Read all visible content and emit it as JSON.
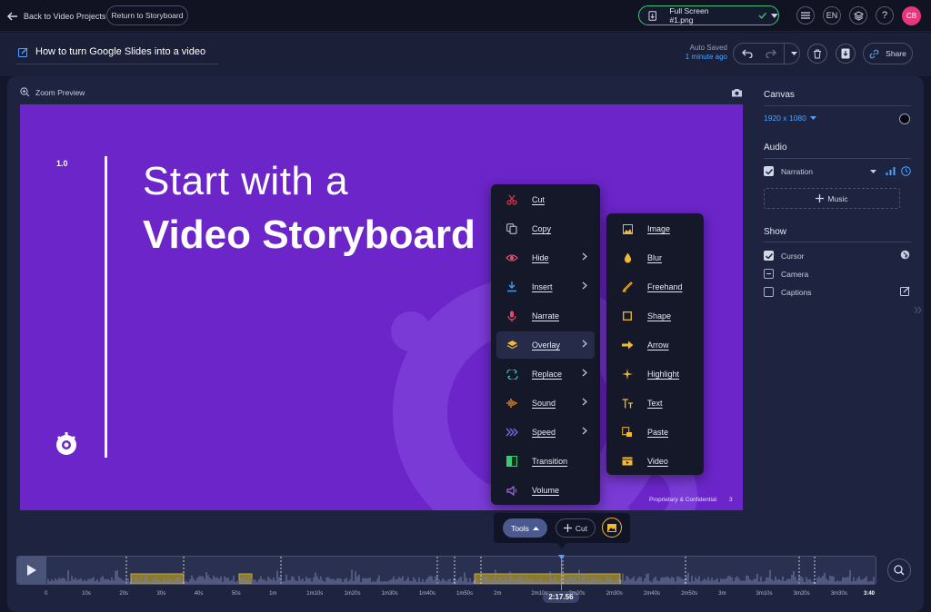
{
  "topbar": {
    "back_label": "Back to Video Projects",
    "return_label": "Return to Storyboard",
    "file_name": "Full Screen #1.png",
    "lang": "EN",
    "help": "?",
    "avatar_initials": "CB"
  },
  "header": {
    "project_title": "How to turn Google Slides into a video",
    "autosave_label": "Auto Saved",
    "autosave_time": "1 minute ago",
    "share_label": "Share"
  },
  "preview": {
    "zoom_label": "Zoom Preview"
  },
  "slide": {
    "number": "1.0",
    "line1": "Start with a",
    "line2": "Video Storyboard",
    "footer": "Proprietary & Confidential",
    "page": "3"
  },
  "tools_menu": {
    "items": [
      {
        "label": "Cut",
        "icon": "scissors-icon",
        "has_submenu": false,
        "color": "#e0344e"
      },
      {
        "label": "Copy",
        "icon": "copy-icon",
        "has_submenu": false,
        "color": "#c9ccde"
      },
      {
        "label": "Hide",
        "icon": "eye-icon",
        "has_submenu": true,
        "color": "#e0566a"
      },
      {
        "label": "Insert",
        "icon": "insert-icon",
        "has_submenu": true,
        "color": "#4a9af0"
      },
      {
        "label": "Narrate",
        "icon": "microphone-icon",
        "has_submenu": false,
        "color": "#e04a6a"
      },
      {
        "label": "Overlay",
        "icon": "layers-icon",
        "has_submenu": true,
        "color": "#f2b830"
      },
      {
        "label": "Replace",
        "icon": "replace-icon",
        "has_submenu": true,
        "color": "#36c4c8"
      },
      {
        "label": "Sound",
        "icon": "sound-icon",
        "has_submenu": true,
        "color": "#f08a2a"
      },
      {
        "label": "Speed",
        "icon": "speed-icon",
        "has_submenu": true,
        "color": "#7a6cf0"
      },
      {
        "label": "Transition",
        "icon": "transition-icon",
        "has_submenu": false,
        "color": "#3cc870"
      },
      {
        "label": "Volume",
        "icon": "volume-icon",
        "has_submenu": false,
        "color": "#a86cf0"
      }
    ]
  },
  "overlay_menu": {
    "items": [
      {
        "label": "Image",
        "icon": "image-icon"
      },
      {
        "label": "Blur",
        "icon": "blur-drop-icon"
      },
      {
        "label": "Freehand",
        "icon": "freehand-icon"
      },
      {
        "label": "Shape",
        "icon": "square-icon"
      },
      {
        "label": "Arrow",
        "icon": "arrow-icon"
      },
      {
        "label": "Highlight",
        "icon": "sparkle-icon"
      },
      {
        "label": "Text",
        "icon": "text-icon"
      },
      {
        "label": "Paste",
        "icon": "paste-icon"
      },
      {
        "label": "Video",
        "icon": "video-icon"
      }
    ],
    "accent": "#f2b830"
  },
  "toolsbar": {
    "tools_label": "Tools",
    "cut_label": "Cut"
  },
  "sidebar": {
    "canvas_heading": "Canvas",
    "resolution": "1920 x 1080",
    "audio_heading": "Audio",
    "narration_label": "Narration",
    "music_label": "Music",
    "show_heading": "Show",
    "show_items": [
      {
        "label": "Cursor",
        "state": "checked"
      },
      {
        "label": "Camera",
        "state": "partial"
      },
      {
        "label": "Captions",
        "state": "unchecked"
      }
    ]
  },
  "timeline": {
    "current_time": "2:17.56",
    "end_time": "3:40",
    "ticks": [
      "0",
      "10s",
      "20s",
      "30s",
      "40s",
      "50s",
      "1m",
      "1m10s",
      "1m20s",
      "1m30s",
      "1m40s",
      "1m50s",
      "2m",
      "2m10s",
      "2m20s",
      "2m30s",
      "2m40s",
      "2m50s",
      "3m",
      "3m10s",
      "3m20s",
      "3m30s",
      "3:40"
    ]
  },
  "colors": {
    "accent_blue": "#4da3ff",
    "slide_purple": "#6b25c9",
    "overlay_yellow": "#f2b830",
    "avatar_pink": "#e8357c",
    "saved_green": "#3ec47a"
  }
}
